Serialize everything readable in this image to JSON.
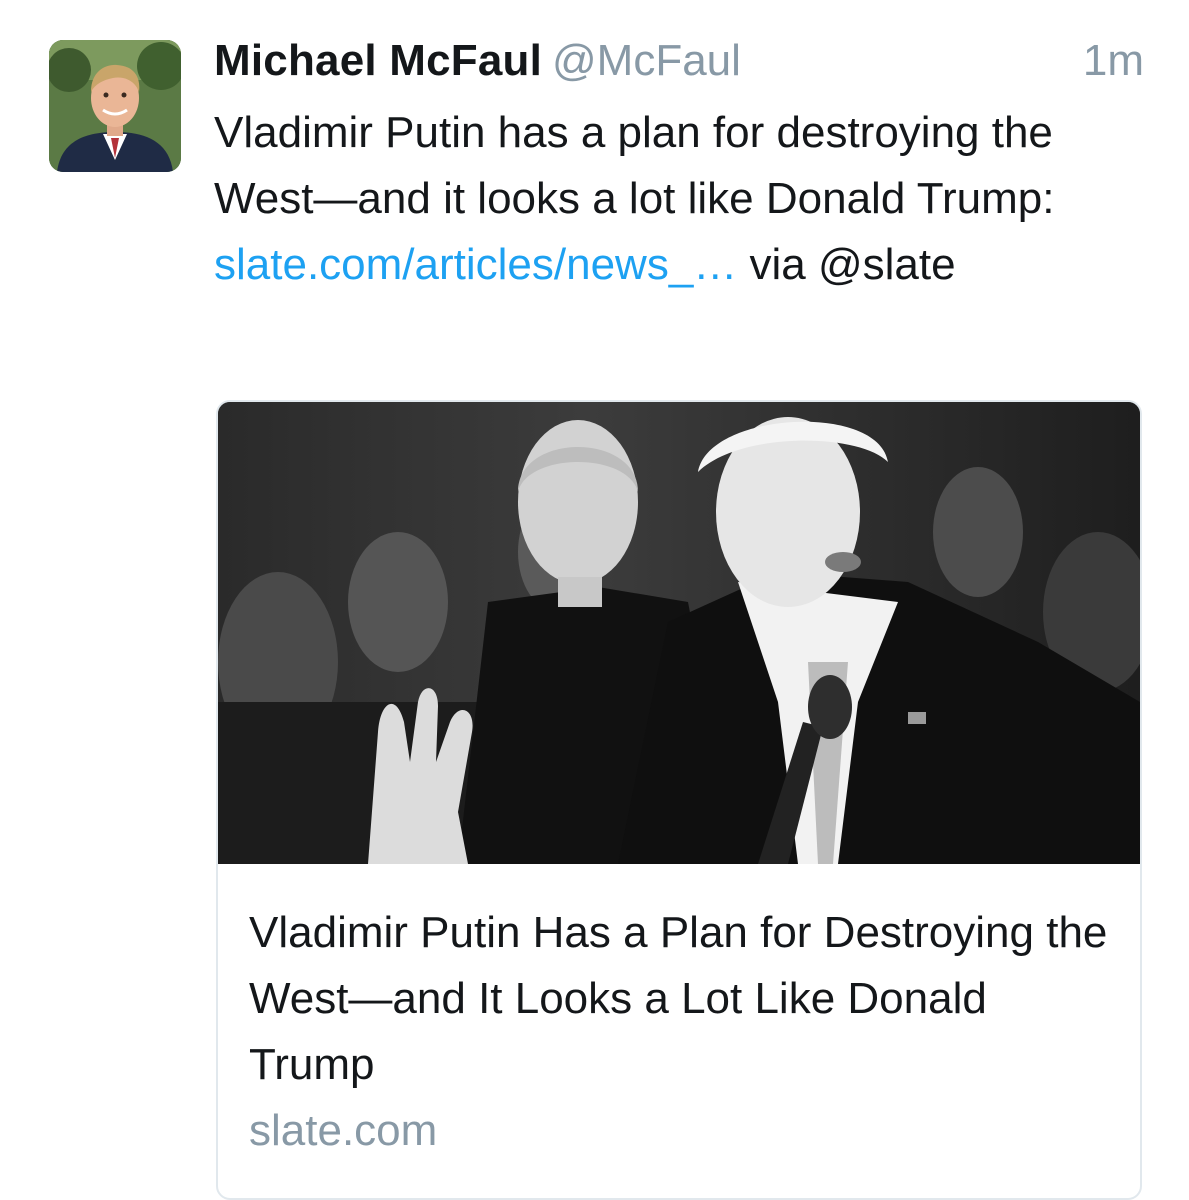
{
  "tweet": {
    "author": {
      "display_name": "Michael McFaul",
      "handle": "@McFaul",
      "avatar_icon": "profile-photo"
    },
    "timestamp": "1m",
    "text": {
      "before_link": "Vladimir Putin has a plan for destroying the West—and it looks a lot like Donald Trump: ",
      "link": "slate.com/articles/news_…",
      "after_link": " via @slate"
    },
    "card": {
      "image_icon": "article-photo",
      "title": "Vladimir Putin Has a Plan for Destroying the West—and It Looks a Lot Like Donald Trump",
      "domain": "slate.com"
    }
  },
  "colors": {
    "text": "#14171a",
    "muted": "#8899a6",
    "link": "#1da1f2",
    "card_border": "#e1e8ed"
  }
}
